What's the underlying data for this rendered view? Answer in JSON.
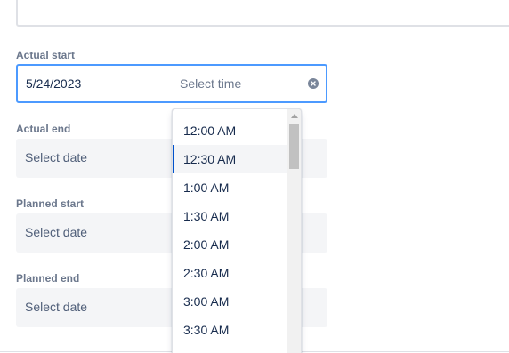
{
  "fields": {
    "actual_start": {
      "label": "Actual start",
      "date_value": "5/24/2023",
      "time_placeholder": "Select time"
    },
    "actual_end": {
      "label": "Actual end",
      "date_placeholder": "Select date"
    },
    "planned_start": {
      "label": "Planned start",
      "date_placeholder": "Select date"
    },
    "planned_end": {
      "label": "Planned end",
      "date_placeholder": "Select date"
    }
  },
  "time_dropdown": {
    "selected": "12:30 AM",
    "options": [
      "12:00 AM",
      "12:30 AM",
      "1:00 AM",
      "1:30 AM",
      "2:00 AM",
      "2:30 AM",
      "3:00 AM",
      "3:30 AM"
    ]
  },
  "icons": {
    "clear": "clear-circle-icon",
    "scroll_up": "scroll-up-arrow-icon"
  },
  "colors": {
    "focus_border": "#4c9aff",
    "selected_indicator": "#0052cc",
    "field_bg": "#f4f5f7",
    "label": "#6b778c",
    "text": "#172b4d"
  }
}
